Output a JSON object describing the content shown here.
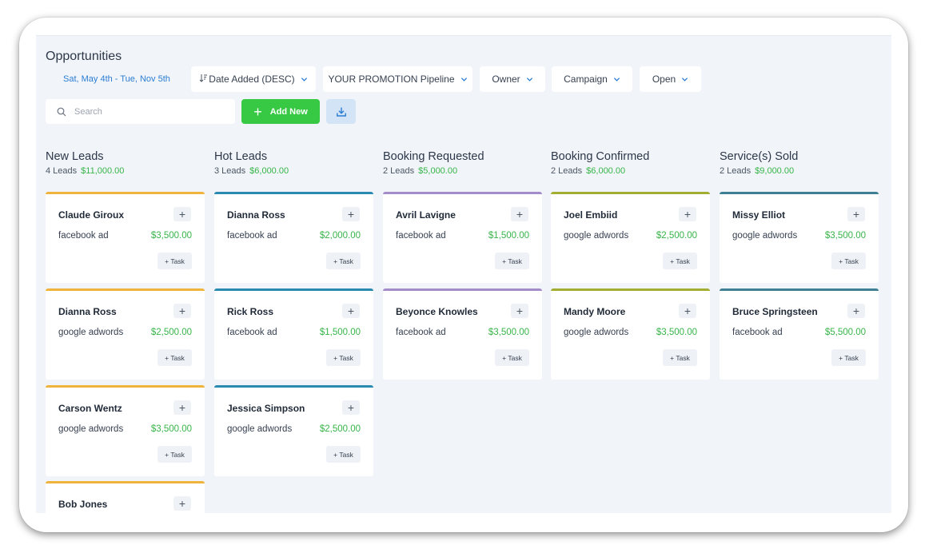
{
  "page": {
    "title": "Opportunities"
  },
  "filters": {
    "date_range": "Sat, May 4th - Tue, Nov 5th",
    "sort": "Date Added (DESC)",
    "pipeline": "YOUR PROMOTION Pipeline",
    "owner": "Owner",
    "campaign": "Campaign",
    "status": "Open"
  },
  "search": {
    "placeholder": "Search"
  },
  "toolbar": {
    "add_label": "Add New"
  },
  "colors": {
    "accent_green": "#37c943",
    "new_leads": "#f0b43c",
    "hot_leads": "#2a8ab0",
    "booking_requested": "#a48cc8",
    "booking_confirmed": "#a2ad31",
    "services_sold": "#3f7f93"
  },
  "columns": [
    {
      "title": "New Leads",
      "count": "4 Leads",
      "total": "$11,000.00",
      "cards": [
        {
          "name": "Claude Giroux",
          "source": "facebook ad",
          "value": "$3,500.00",
          "task": "+ Task"
        },
        {
          "name": "Dianna Ross",
          "source": "google adwords",
          "value": "$2,500.00",
          "task": "+ Task"
        },
        {
          "name": "Carson Wentz",
          "source": "google adwords",
          "value": "$3,500.00",
          "task": "+ Task"
        },
        {
          "name": "Bob Jones",
          "source": "",
          "value": "",
          "task": ""
        }
      ]
    },
    {
      "title": "Hot Leads",
      "count": "3 Leads",
      "total": "$6,000.00",
      "cards": [
        {
          "name": "Dianna Ross",
          "source": "facebook ad",
          "value": "$2,000.00",
          "task": "+ Task"
        },
        {
          "name": "Rick Ross",
          "source": "facebook ad",
          "value": "$1,500.00",
          "task": "+ Task"
        },
        {
          "name": "Jessica Simpson",
          "source": "google adwords",
          "value": "$2,500.00",
          "task": "+ Task"
        }
      ]
    },
    {
      "title": "Booking Requested",
      "count": "2 Leads",
      "total": "$5,000.00",
      "cards": [
        {
          "name": "Avril Lavigne",
          "source": "facebook ad",
          "value": "$1,500.00",
          "task": "+ Task"
        },
        {
          "name": "Beyonce Knowles",
          "source": "facebook ad",
          "value": "$3,500.00",
          "task": "+ Task"
        }
      ]
    },
    {
      "title": "Booking Confirmed",
      "count": "2 Leads",
      "total": "$6,000.00",
      "cards": [
        {
          "name": "Joel Embiid",
          "source": "google adwords",
          "value": "$2,500.00",
          "task": "+ Task"
        },
        {
          "name": "Mandy Moore",
          "source": "google adwords",
          "value": "$3,500.00",
          "task": "+ Task"
        }
      ]
    },
    {
      "title": "Service(s) Sold",
      "count": "2 Leads",
      "total": "$9,000.00",
      "cards": [
        {
          "name": "Missy Elliot",
          "source": "google adwords",
          "value": "$3,500.00",
          "task": "+ Task"
        },
        {
          "name": "Bruce Springsteen",
          "source": "facebook ad",
          "value": "$5,500.00",
          "task": "+ Task"
        }
      ]
    }
  ]
}
